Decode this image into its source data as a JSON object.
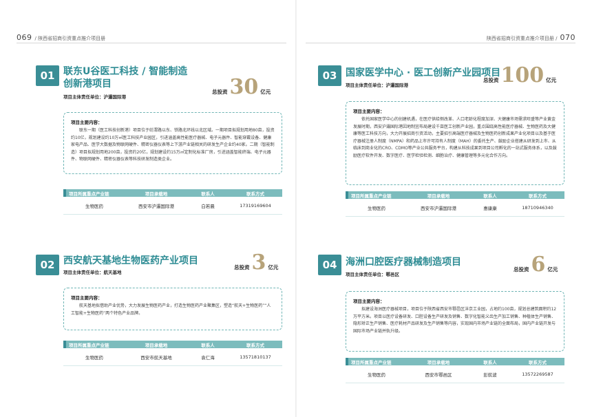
{
  "left_page": {
    "page_number": "069",
    "running_title": "/ 陕西省招商引资重点推介项目册"
  },
  "right_page": {
    "page_number": "070",
    "running_title": "陕西省招商引资重点推介项目册 /"
  },
  "labels": {
    "responsible_unit": "项目主体责任单位：",
    "total_investment": "总投资",
    "investment_unit": "亿元",
    "main_content": "项目主要内容：",
    "table_headers": [
      "项目所属重点产业链",
      "项目承载地",
      "联系人",
      "联系方式"
    ]
  },
  "projects": [
    {
      "number": "01",
      "title_line1": "联东U谷医工科技 / 智能制造",
      "title_line2": "创新港项目",
      "responsible_unit": "沪灞国际港",
      "investment": "30",
      "content": "联东一期（医工科技创新港）项目位于纺渭路以东、铁路北环线以北区域。一期项目拟规划用地80亩，投资约10亿，规划建设约10万㎡医工科技产业园区，引进涵盖高性能医疗器械、电子元器件、智能穿戴设备、健康家电产品、医学大数据及物联网硬件、精密仪器仪表等上下游产业链相关的研发生产企业约40家。二期（智能制造）项目拟规划用地200亩，投资约20亿，规划建设约15万㎡定制化标准厂房，引进涵盖智能终端、电子元器件、物联网硬件、精密仪器仪表等科技研发制造类企业。",
      "row": [
        "生物医药",
        "西安市沪灞国际港",
        "白若晨",
        "17319169604"
      ]
    },
    {
      "number": "02",
      "title_line1": "西安航天基地生物医药产业项目",
      "title_line2": "",
      "responsible_unit": "航天基地",
      "investment": "3",
      "content": "航天基地拟借助产业优势，大力发展生物医药产业，打造生物医药产业聚集区，塑造“航天+生物医药”“人工智能+生物医药”两个特色产业品牌。",
      "row": [
        "生物医药",
        "西安市航天基地",
        "袁仁海",
        "13571810137"
      ]
    },
    {
      "number": "03",
      "title_line1": "国家医学中心 · 医工创新产业园项目",
      "title_line2": "",
      "responsible_unit": "沪灞国际港",
      "investment": "100",
      "content": "依托国家医学中心的创建机遇，在医疗供给侧改革、人口老龄化程度加深、大健康市场需求旺盛等产业黄金发展时期，西安沪灞国际港因地制宜布局建设千亩医工创新产业园，重点围绕高性能医疗器械、生物医药及大健康等医工科技方向，大力开展招商引资活动，主要招引高端医疗器械及生物医药创新成果产业化项目以及基于医疗器械注册人制度（NMPA）和药品上市许可持有人制度（MAH）的委托生产、鼓励企业搭建从研发到上市、从临床到商业化的CRO、CDMO等产业公共服务平台，构建从科技成果到项目公司孵化的一站式服务体系，以及鼓励医疗软件开发、数字医疗、医学检验检测、细胞治疗、健康管理等多元化合作方向。",
      "row": [
        "生物医药",
        "西安市沪灞国际港",
        "惠康康",
        "18710946340"
      ]
    },
    {
      "number": "04",
      "title_line1": "海洲口腔医疗器械制造项目",
      "title_line2": "",
      "responsible_unit": "鄠邑区",
      "investment": "6",
      "content": "拟建设海洲医疗器械项目，项目位于陕西省西安市鄠邑区沣京工业园，占地约100亩，规划总建筑面积约12万平方米。项目以医疗设备研发、口腔设备生产研发及销售、数字化智能义齿生产加工销售、种植体生产销售、隐形矫正生产销售、医疗耗材产品研发及生产销售等内容，实现国内市场产业链的全面布局，国内产业链开发与国际市场产业链并轨升级。",
      "row": [
        "生物医药",
        "西安市鄠邑区",
        "彭航波",
        "13572269587"
      ]
    }
  ]
}
